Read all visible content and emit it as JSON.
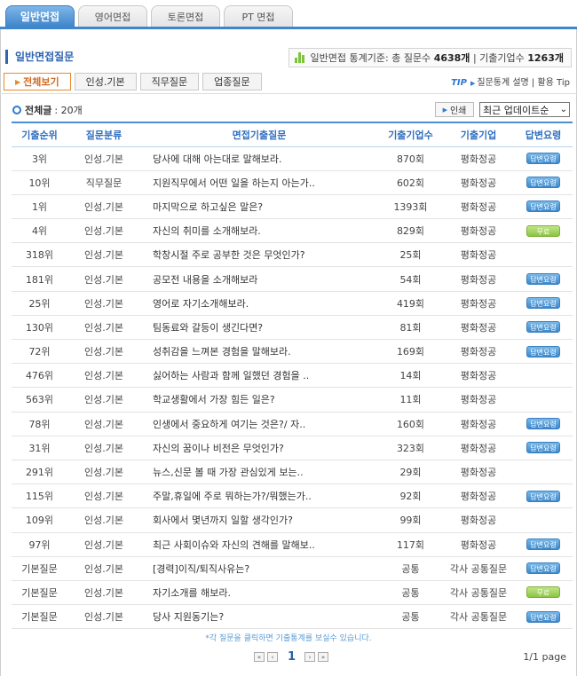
{
  "top_tabs": [
    {
      "label": "일반면접",
      "active": true
    },
    {
      "label": "영어면접",
      "active": false
    },
    {
      "label": "토론면접",
      "active": false
    },
    {
      "label": "PT 면접",
      "active": false
    }
  ],
  "section_title": "일반면접질문",
  "stats": {
    "prefix": "일반면접 통계기준: 총 질문수",
    "questions": "4638개",
    "sep": "| 기출기업수",
    "companies": "1263개",
    "icon": "bar-chart-icon"
  },
  "sub_tabs": [
    {
      "label": "전체보기",
      "active": true
    },
    {
      "label": "인성.기본",
      "active": false
    },
    {
      "label": "직무질문",
      "active": false
    },
    {
      "label": "업종질문",
      "active": false
    }
  ],
  "tip": {
    "label": "TIP",
    "text": "질문통계 설명 | 활용 Tip"
  },
  "count": {
    "label": "전체글",
    "value": ": 20개"
  },
  "print_label": "인쇄",
  "sort": {
    "selected": "최근 업데이트순"
  },
  "columns": [
    "기출순위",
    "질문분류",
    "면접기출질문",
    "기출기업수",
    "기출기업",
    "답변요령"
  ],
  "rows": [
    {
      "rank": "3위",
      "category": "인성.기본",
      "question": "당사에 대해 아는대로 말해보라.",
      "count": "870회",
      "company": "평화정공",
      "badge": "blue"
    },
    {
      "rank": "10위",
      "category": "직무질문",
      "question": "지원직무에서 어떤 일을 하는지 아는가..",
      "count": "602회",
      "company": "평화정공",
      "badge": "blue"
    },
    {
      "rank": "1위",
      "category": "인성.기본",
      "question": "마지막으로 하고싶은 말은?",
      "count": "1393회",
      "company": "평화정공",
      "badge": "blue"
    },
    {
      "rank": "4위",
      "category": "인성.기본",
      "question": "자신의 취미를 소개해보라.",
      "count": "829회",
      "company": "평화정공",
      "badge": "green"
    },
    {
      "rank": "318위",
      "category": "인성.기본",
      "question": "학창시절 주로 공부한 것은 무엇인가?",
      "count": "25회",
      "company": "평화정공",
      "badge": ""
    },
    {
      "rank": "181위",
      "category": "인성.기본",
      "question": "공모전 내용을 소개해보라",
      "count": "54회",
      "company": "평화정공",
      "badge": "blue"
    },
    {
      "rank": "25위",
      "category": "인성.기본",
      "question": "영어로 자기소개해보라.",
      "count": "419회",
      "company": "평화정공",
      "badge": "blue"
    },
    {
      "rank": "130위",
      "category": "인성.기본",
      "question": "팀동료와 갈등이 생긴다면?",
      "count": "81회",
      "company": "평화정공",
      "badge": "blue"
    },
    {
      "rank": "72위",
      "category": "인성.기본",
      "question": "성취감을 느껴본 경험을 말해보라.",
      "count": "169회",
      "company": "평화정공",
      "badge": "blue"
    },
    {
      "rank": "476위",
      "category": "인성.기본",
      "question": "싫어하는 사람과 함께 일했던 경험을 ..",
      "count": "14회",
      "company": "평화정공",
      "badge": ""
    },
    {
      "rank": "563위",
      "category": "인성.기본",
      "question": "학교생활에서 가장 힘든 일은?",
      "count": "11회",
      "company": "평화정공",
      "badge": ""
    },
    {
      "rank": "78위",
      "category": "인성.기본",
      "question": "인생에서 중요하게 여기는 것은?/ 자..",
      "count": "160회",
      "company": "평화정공",
      "badge": "blue"
    },
    {
      "rank": "31위",
      "category": "인성.기본",
      "question": "자신의 꿈이나 비전은 무엇인가?",
      "count": "323회",
      "company": "평화정공",
      "badge": "blue"
    },
    {
      "rank": "291위",
      "category": "인성.기본",
      "question": "뉴스,신문 볼 때 가장 관심있게 보는..",
      "count": "29회",
      "company": "평화정공",
      "badge": ""
    },
    {
      "rank": "115위",
      "category": "인성.기본",
      "question": "주말,휴일에 주로 뭐하는가?/뭐했는가..",
      "count": "92회",
      "company": "평화정공",
      "badge": "blue"
    },
    {
      "rank": "109위",
      "category": "인성.기본",
      "question": "회사에서 몇년까지 일할 생각인가?",
      "count": "99회",
      "company": "평화정공",
      "badge": ""
    },
    {
      "rank": "97위",
      "category": "인성.기본",
      "question": "최근 사회이슈와 자신의 견해를 말해보..",
      "count": "117회",
      "company": "평화정공",
      "badge": "blue"
    },
    {
      "rank": "기본질문",
      "category": "인성.기본",
      "question": "[경력]이직/퇴직사유는?",
      "count": "공통",
      "company": "각사 공통질문",
      "badge": "blue"
    },
    {
      "rank": "기본질문",
      "category": "인성.기본",
      "question": "자기소개를 해보라.",
      "count": "공통",
      "company": "각사 공통질문",
      "badge": "green"
    },
    {
      "rank": "기본질문",
      "category": "인성.기본",
      "question": "당사 지원동기는?",
      "count": "공통",
      "company": "각사 공통질문",
      "badge": "blue"
    }
  ],
  "badge_labels": {
    "blue": "답변요령",
    "green": "무료"
  },
  "badge_colors": {
    "blue": "#3c89cf",
    "green": "#8bc441"
  },
  "footer_note": "*각 질문을 클릭하면 기출통계를 보실수 있습니다.",
  "pagination": {
    "current": "1",
    "info": "1/1 page"
  },
  "accent_color": "#3f86cc"
}
